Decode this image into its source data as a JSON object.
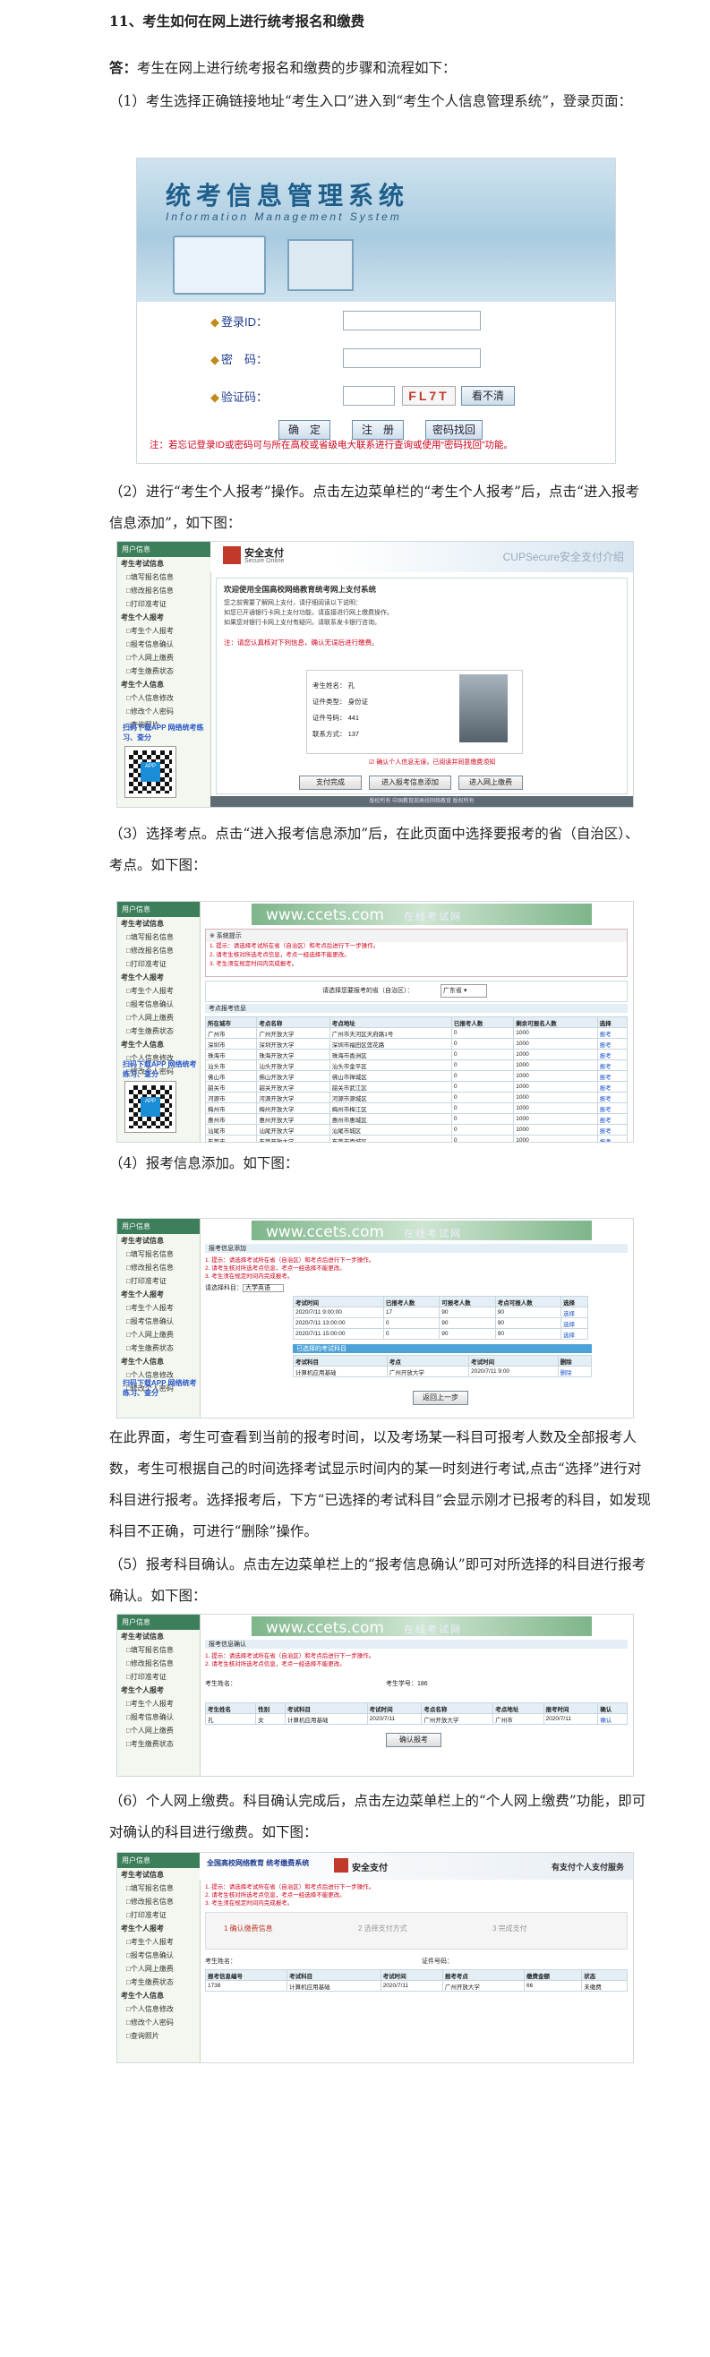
{
  "qa": {
    "question": "11、考生如何在网上进行统考报名和缴费",
    "answer_label": "答：",
    "answer_text": "考生在网上进行统考报名和缴费的步骤和流程如下：",
    "step1": "（1）考生选择正确链接地址“考生入口”进入到“考生个人信息管理系统”，登录页面：",
    "step2": "（2）进行“考生个人报考”操作。点击左边菜单栏的“考生个人报考”后，点击“进入报考信息添加”，如下图：",
    "step3": "（3）选择考点。点击“进入报考信息添加”后，在此页面中选择要报考的省（自治区）、考点。如下图：",
    "step4": "（4）报考信息添加。如下图：",
    "step4_desc": "在此界面，考生可查看到当前的报考时间，以及考场某一科目可报考人数及全部报考人数，考生可根据自己的时间选择考试显示时间内的某一时刻进行考试,点击“选择”进行对科目进行报考。选择报考后，下方“已选择的考试科目”会显示刚才已报考的科目，如发现科目不正确，可进行“删除”操作。",
    "step5": "（5）报考科目确认。点击左边菜单栏上的“报考信息确认”即可对所选择的科目进行报考确认。如下图：",
    "step6": "（6）个人网上缴费。科目确认完成后，点击左边菜单栏上的“个人网上缴费”功能，即可对确认的科目进行缴费。如下图："
  },
  "login": {
    "title": "统考信息管理系统",
    "subtitle": "Information  Management  System",
    "id_label": "登录ID：",
    "pwd_label": "密　码：",
    "code_label": "验证码：",
    "captcha": "FL7T",
    "refresh": "看不清",
    "ok": "确　定",
    "register": "注　册",
    "recover": "密码找回",
    "note": "注：若忘记登录ID或密码可与所在高校或省级电大联系进行查询或使用“密码找回”功能。"
  },
  "shot2": {
    "side_title": "用户信息",
    "side_items": [
      "考生考试信息",
      "□填写报名信息",
      "□修改报名信息",
      "□打印准考证",
      "考生个人报考",
      "□考生个人报考",
      "□报考信息确认",
      "□个人网上缴费",
      "□考生缴费状态",
      "考生个人信息",
      "□个人信息修改",
      "□修改个人密码",
      "□查询照片"
    ],
    "app_text": "扫码下载APP 网络统考练习、查分",
    "logo": "安全支付",
    "logo_sub": "Secure Online",
    "banner_right": "CUPSecure安全支付介绍",
    "welcome": "欢迎使用全国高校网络教育统考网上支付系统",
    "intro_lines": [
      "您之前需要了解网上支付，请仔细阅读以下说明：",
      "如您已开通银行卡网上支付功能，请直接进行网上缴费操作。",
      "如果您对银行卡网上支付有疑问，请联系发卡银行咨询。"
    ],
    "warning": "注：请您认真核对下列信息，确认无误后进行缴费。",
    "info_labels": [
      "考生姓名：",
      "证件类型：",
      "证件号码：",
      "联系方式："
    ],
    "info_values": [
      "孔",
      "身份证",
      "441",
      "137"
    ],
    "agree": "确认个人信息无误，已阅读并同意缴费须知",
    "btns": [
      "支付完成",
      "进入报考信息添加",
      "进入网上缴费"
    ],
    "footer": "版权所有 中国教育部高校网络教育 版权所有"
  },
  "shot3": {
    "url": "www.ccets.com",
    "slogan": "在线考试网",
    "prompt_title": "※ 系统提示",
    "notes": [
      "1. 提示：请选择考试所在省（自治区）和考点后进行下一步操作。",
      "2. 请考生核对所选考点信息，考点一经选择不能更改。",
      "3. 考生须在规定时间内完成报考。"
    ],
    "region_label": "请选择您要报考的省（自治区）：",
    "region_value": "广东省",
    "table_title": "考点报考信息",
    "table_headers": [
      "所在城市",
      "考点名称",
      "考点地址",
      "已报考人数",
      "剩余可报名人数",
      "选择"
    ],
    "rows": [
      [
        "广州市",
        "广州开放大学",
        "广州市天河区天府路1号",
        "0",
        "1000",
        "报考"
      ],
      [
        "深圳市",
        "深圳开放大学",
        "深圳市福田区莲花路",
        "0",
        "1000",
        "报考"
      ],
      [
        "珠海市",
        "珠海开放大学",
        "珠海市香洲区",
        "0",
        "1000",
        "报考"
      ],
      [
        "汕头市",
        "汕头开放大学",
        "汕头市金平区",
        "0",
        "1000",
        "报考"
      ],
      [
        "佛山市",
        "佛山开放大学",
        "佛山市禅城区",
        "0",
        "1000",
        "报考"
      ],
      [
        "韶关市",
        "韶关开放大学",
        "韶关市武江区",
        "0",
        "1000",
        "报考"
      ],
      [
        "河源市",
        "河源开放大学",
        "河源市源城区",
        "0",
        "1000",
        "报考"
      ],
      [
        "梅州市",
        "梅州开放大学",
        "梅州市梅江区",
        "0",
        "1000",
        "报考"
      ],
      [
        "惠州市",
        "惠州开放大学",
        "惠州市惠城区",
        "0",
        "1000",
        "报考"
      ],
      [
        "汕尾市",
        "汕尾开放大学",
        "汕尾市城区",
        "0",
        "1000",
        "报考"
      ],
      [
        "东莞市",
        "东莞开放大学",
        "东莞市南城区",
        "0",
        "1000",
        "报考"
      ],
      [
        "中山市",
        "中山开放大学",
        "中山市东区",
        "0",
        "1000",
        "报考"
      ],
      [
        "江门市",
        "江门开放大学",
        "江门市蓬江区",
        "0",
        "1000",
        "报考"
      ],
      [
        "阳江市",
        "阳江开放大学",
        "阳江市江城区",
        "0",
        "1000",
        "报考"
      ],
      [
        "湛江市",
        "湛江开放大学",
        "湛江市赤坎区",
        "0",
        "1000",
        "报考"
      ],
      [
        "茂名市",
        "茂名开放大学",
        "茂名市茂南区",
        "0",
        "1000",
        "报考"
      ],
      [
        "肇庆市",
        "肇庆开放大学",
        "肇庆市端州区",
        "0",
        "1000",
        "报考"
      ],
      [
        "清远市",
        "清远开放大学",
        "清远市清城区",
        "0",
        "1000",
        "报考"
      ]
    ]
  },
  "shot4": {
    "title": "报考信息添加",
    "subject_label": "请选择科目：",
    "subject_value": "大学英语",
    "headers": [
      "考试时间",
      "已报考人数",
      "可报考人数",
      "考点可报人数",
      "选择"
    ],
    "rows": [
      [
        "2020/7/11 9:00:00",
        "17",
        "90",
        "90",
        "选择"
      ],
      [
        "2020/7/11 13:00:00",
        "0",
        "90",
        "90",
        "选择"
      ],
      [
        "2020/7/11 15:00:00",
        "0",
        "90",
        "90",
        "选择"
      ]
    ],
    "selected_title": "已选择的考试科目",
    "selected_headers": [
      "考试科目",
      "考点",
      "考试时间",
      "删除"
    ],
    "selected_row": [
      "计算机应用基础",
      "广州开放大学",
      "2020/7/11 9:00",
      "删除"
    ],
    "next_btn": "返回上一步"
  },
  "shot5": {
    "title": "报考信息确认",
    "name_label": "考生姓名：",
    "id_label": "考生学号：",
    "id_value": "186",
    "headers": [
      "考生姓名",
      "性别",
      "考试科目",
      "考试时间",
      "考点名称",
      "考点地址",
      "报考时间",
      "确认"
    ],
    "row": [
      "孔",
      "女",
      "计算机应用基础",
      "2020/7/11",
      "广州开放大学",
      "广州市",
      "2020/7/11",
      "确认"
    ],
    "confirm_btn": "确认报考"
  },
  "shot6": {
    "top_left": "全国高校网络教育 统考缴费系统",
    "logo": "安全支付",
    "right": "有支付个人支付服务",
    "steps": [
      "1 确认缴费信息",
      "2 选择支付方式",
      "3 完成支付"
    ],
    "name_label": "考生姓名：",
    "id_label": "证件号码：",
    "headers": [
      "报考信息编号",
      "考试科目",
      "考试时间",
      "报考考点",
      "缴费金额",
      "状态"
    ],
    "row": [
      "1738",
      "计算机应用基础",
      "2020/7/11",
      "广州开放大学",
      "66",
      "未缴费"
    ]
  }
}
